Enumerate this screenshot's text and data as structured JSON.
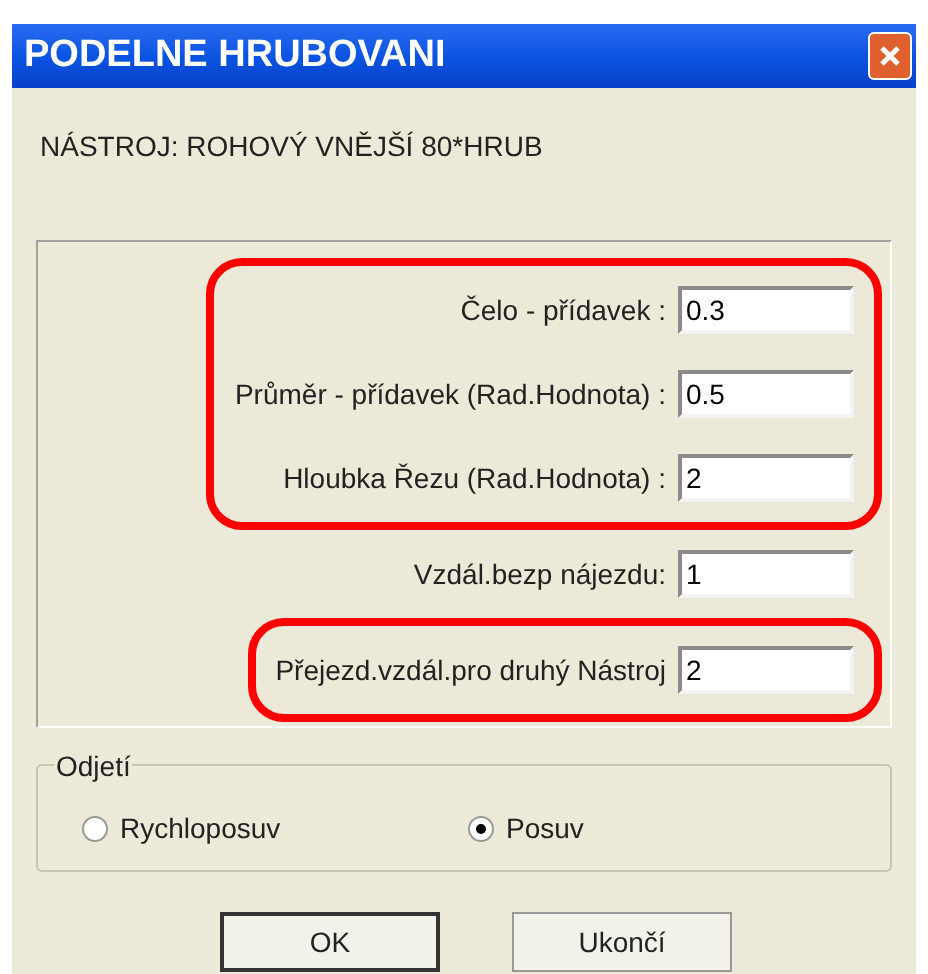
{
  "window": {
    "title": "PODELNE HRUBOVANI"
  },
  "tool_label": "NÁSTROJ: ROHOVÝ VNĚJŠÍ 80*HRUB",
  "field_groups": [
    {
      "highlighted": true,
      "fields": [
        {
          "label": "Čelo - přídavek :",
          "value": "0.3"
        },
        {
          "label": "Průměr - přídavek (Rad.Hodnota) :",
          "value": "0.5"
        },
        {
          "label": "Hloubka Řezu (Rad.Hodnota) :",
          "value": "2"
        }
      ]
    },
    {
      "highlighted": false,
      "fields": [
        {
          "label": "Vzdál.bezp nájezdu:",
          "value": "1"
        }
      ]
    },
    {
      "highlighted": true,
      "fields": [
        {
          "label": "Přejezd.vzdál.pro druhý Nástroj",
          "value": "2"
        }
      ]
    }
  ],
  "retract": {
    "title": "Odjetí",
    "options": [
      {
        "label": "Rychloposuv",
        "selected": false
      },
      {
        "label": "Posuv",
        "selected": true
      }
    ]
  },
  "buttons": [
    {
      "label": "OK",
      "default": true
    },
    {
      "label": "Ukončí",
      "default": false
    }
  ]
}
